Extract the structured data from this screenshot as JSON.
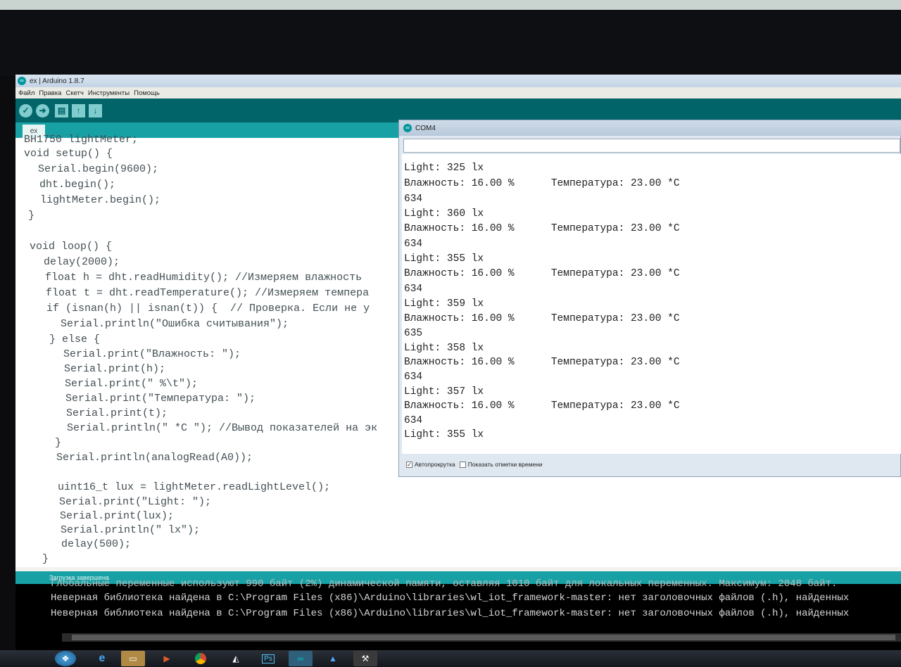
{
  "window": {
    "title": "ex | Arduino 1.8.7"
  },
  "menu": [
    "Файл",
    "Правка",
    "Скетч",
    "Инструменты",
    "Помощь"
  ],
  "toolbar": {
    "verify_icon": "check-icon",
    "upload_icon": "arrow-right-icon",
    "new_icon": "file-icon",
    "open_icon": "arrow-up-icon",
    "save_icon": "arrow-down-icon"
  },
  "tab": {
    "label": "ex"
  },
  "code": [
    "BH1750 lightMeter;",
    "void setup() {",
    "  Serial.begin(9600);",
    "  dht.begin();",
    "  lightMeter.begin();",
    "}",
    "",
    "void loop() {",
    "  delay(2000);",
    "  float h = dht.readHumidity(); //Измеряем влажность",
    "  float t = dht.readTemperature(); //Измеряем темпера",
    "  if (isnan(h) || isnan(t)) {  // Проверка. Если не у",
    "    Serial.println(\"Ошибка считывания\");",
    "  } else {",
    "    Serial.print(\"Влажность: \");",
    "    Serial.print(h);",
    "    Serial.print(\" %\\t\");",
    "    Serial.print(\"Температура: \");",
    "    Serial.print(t);",
    "    Serial.println(\" *C \"); //Вывод показателей на эк",
    "  }",
    "  Serial.println(analogRead(A0));",
    "",
    "  uint16_t lux = lightMeter.readLightLevel();",
    "  Serial.print(\"Light: \");",
    "  Serial.print(lux);",
    "  Serial.println(\" lx\");",
    "  delay(500);",
    "}"
  ],
  "status": {
    "text": "Загрузка завершена"
  },
  "console": [
    "Глобальные переменные используют 990 байт (2%) динамической памяти, оставляя 1010 байт для локальных переменных. Максимум: 2048 байт.",
    "Неверная библиотека найдена в C:\\Program Files (x86)\\Arduino\\libraries\\wl_iot_framework-master: нет заголовочных файлов (.h), найденных",
    "Неверная библиотека найдена в C:\\Program Files (x86)\\Arduino\\libraries\\wl_iot_framework-master: нет заголовочных файлов (.h), найденных"
  ],
  "serial_monitor": {
    "title": "COM4",
    "lines": [
      "Light: 325 lx",
      "Влажность: 16.00 %\tТемпература: 23.00 *C",
      "634",
      "Light: 360 lx",
      "Влажность: 16.00 %\tТемпература: 23.00 *C",
      "634",
      "Light: 355 lx",
      "Влажность: 16.00 %\tТемпература: 23.00 *C",
      "634",
      "Light: 359 lx",
      "Влажность: 16.00 %\tТемпература: 23.00 *C",
      "635",
      "Light: 358 lx",
      "Влажность: 16.00 %\tТемпература: 23.00 *C",
      "634",
      "Light: 357 lx",
      "Влажность: 16.00 %\tТемпература: 23.00 *C",
      "634",
      "Light: 355 lx"
    ],
    "autoscroll_label": "Автопрокрутка",
    "autoscroll_checked": true,
    "timestamps_label": "Показать отметки времени",
    "timestamps_checked": false
  },
  "taskbar": {
    "icons": [
      "start-icon",
      "ie-icon",
      "explorer-icon",
      "media-icon",
      "chrome-icon",
      "unity-icon",
      "photoshop-icon",
      "arduino-icon",
      "azure-icon",
      "tools-icon"
    ],
    "ps_label": "Ps"
  }
}
